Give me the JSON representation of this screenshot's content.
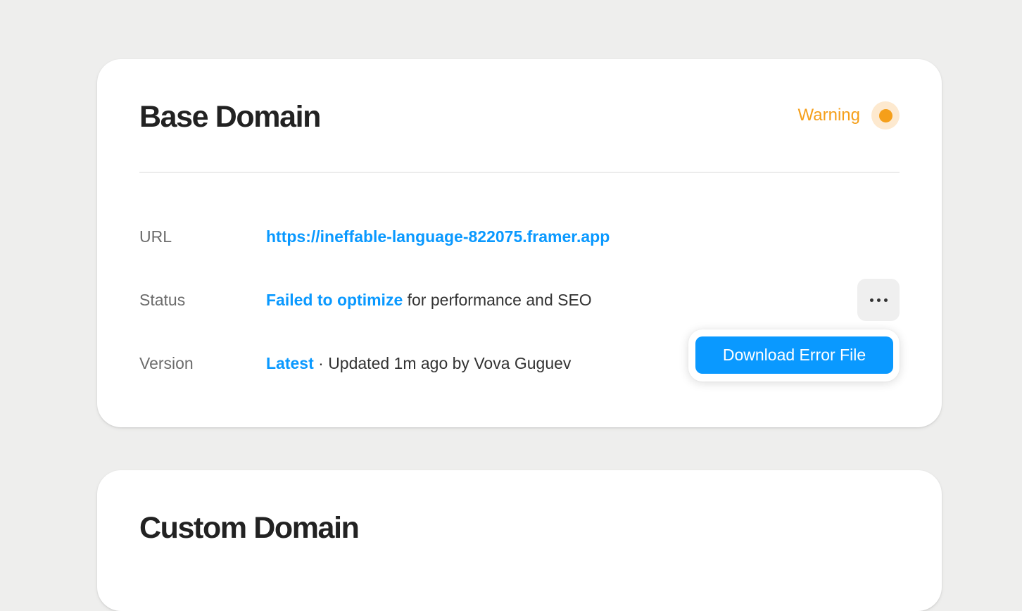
{
  "base_domain": {
    "title": "Base Domain",
    "status_label": "Warning",
    "status_color": "#f59f1a",
    "rows": {
      "url": {
        "label": "URL",
        "link": "https://ineffable-language-822075.framer.app"
      },
      "status": {
        "label": "Status",
        "link": "Failed to optimize",
        "text": " for performance and SEO"
      },
      "version": {
        "label": "Version",
        "link": "Latest",
        "text": " · Updated 1m ago by Vova Guguev"
      }
    },
    "more_button_icon": "more-horizontal-icon",
    "menu": {
      "items": [
        "Download Error File"
      ]
    }
  },
  "custom_domain": {
    "title": "Custom Domain"
  },
  "colors": {
    "accent": "#0a99ff",
    "warning": "#f59f1a",
    "background": "#eeeeed"
  }
}
